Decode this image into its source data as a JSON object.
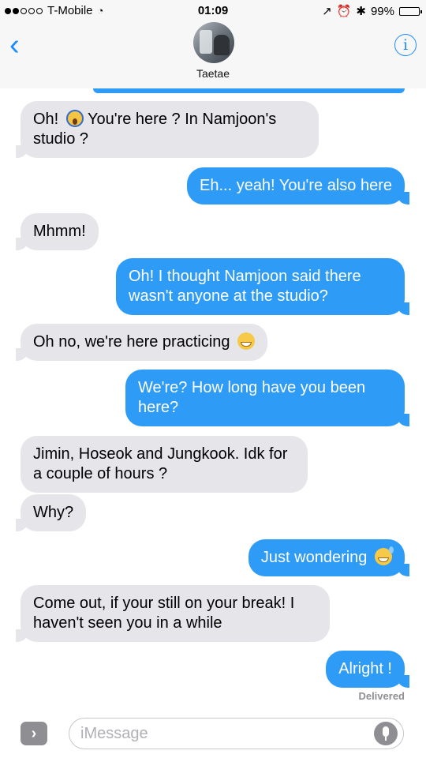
{
  "status_bar": {
    "carrier": "T-Mobile",
    "time": "01:09",
    "battery": "99%",
    "battery_level": 0.99,
    "signal_bars_filled": 2,
    "signal_bars_total": 5
  },
  "header": {
    "contact_name": "Taetae",
    "back_icon": "chevron-left-icon",
    "info_icon": "info-icon",
    "accent_color": "#1a8cff"
  },
  "messages": [
    {
      "direction": "incoming",
      "text": "Oh!",
      "text2": "You're here ? In Namjoon's studio ?",
      "emoji": "face-screaming-in-fear"
    },
    {
      "direction": "outgoing",
      "text": "Eh... yeah! You're also here"
    },
    {
      "direction": "incoming",
      "text": "Mhmm!"
    },
    {
      "direction": "outgoing",
      "text": "Oh! I thought Namjoon said there wasn't anyone at the studio?"
    },
    {
      "direction": "incoming",
      "text": "Oh no, we're here practicing",
      "emoji": "grinning-face"
    },
    {
      "direction": "outgoing",
      "text": "We're? How long have you been here?"
    },
    {
      "direction": "incoming",
      "text": "Jimin, Hoseok and Jungkook. Idk for a couple of hours ?"
    },
    {
      "direction": "incoming",
      "text": "Why?"
    },
    {
      "direction": "outgoing",
      "text": "Just wondering",
      "emoji": "grinning-face-with-sweat"
    },
    {
      "direction": "incoming",
      "text": "Come out, if your still on your break! I haven't seen you in a while"
    },
    {
      "direction": "outgoing",
      "text": "Alright !"
    }
  ],
  "delivered_label": "Delivered",
  "input": {
    "placeholder": "iMessage",
    "value": ""
  },
  "colors": {
    "outgoing_bubble": "#2e9bf7",
    "incoming_bubble": "#e5e5ea"
  }
}
